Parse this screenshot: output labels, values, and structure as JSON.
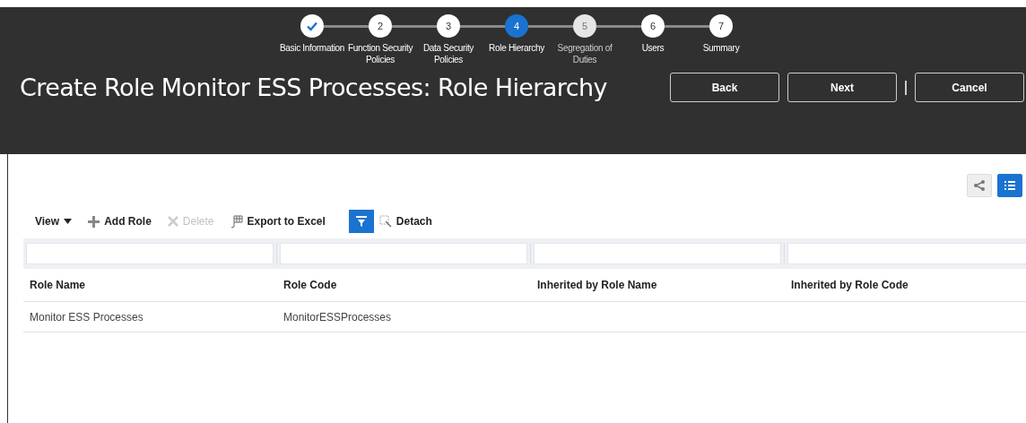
{
  "train": [
    {
      "label": "Basic Information",
      "completed": true,
      "selected": false,
      "disabled": false
    },
    {
      "marker": "2",
      "label": "Function Security Policies",
      "completed": false,
      "selected": false,
      "disabled": false
    },
    {
      "marker": "3",
      "label": "Data Security Policies",
      "completed": false,
      "selected": false,
      "disabled": false
    },
    {
      "marker": "4",
      "label": "Role Hierarchy",
      "completed": false,
      "selected": true,
      "disabled": false
    },
    {
      "marker": "5",
      "label": "Segregation of Duties",
      "completed": false,
      "selected": false,
      "disabled": true
    },
    {
      "marker": "6",
      "label": "Users",
      "completed": false,
      "selected": false,
      "disabled": false
    },
    {
      "marker": "7",
      "label": "Summary",
      "completed": false,
      "selected": false,
      "disabled": false
    }
  ],
  "page_title": "Create Role Monitor ESS Processes: Role Hierarchy",
  "buttons": [
    "Back",
    "Next",
    "Cancel"
  ],
  "view_toggles": [
    {
      "kind": "hierarchy",
      "selected": false
    },
    {
      "kind": "list",
      "selected": true
    }
  ],
  "toolbar": [
    {
      "kind": "menu",
      "label": "View",
      "disabled": false
    },
    {
      "kind": "add",
      "label": "Add Role",
      "disabled": false
    },
    {
      "kind": "delete",
      "label": "Delete",
      "disabled": true
    },
    {
      "kind": "export",
      "label": "Export to Excel",
      "disabled": false
    },
    {
      "kind": "filter",
      "selected": true
    },
    {
      "kind": "detach",
      "label": "Detach",
      "disabled": false
    }
  ],
  "table": {
    "columns": [
      "Role Name",
      "Role Code",
      "Inherited by Role Name",
      "Inherited by Role Code"
    ],
    "rows": [
      [
        "Monitor ESS Processes",
        "MonitorESSProcesses",
        "",
        ""
      ]
    ]
  }
}
